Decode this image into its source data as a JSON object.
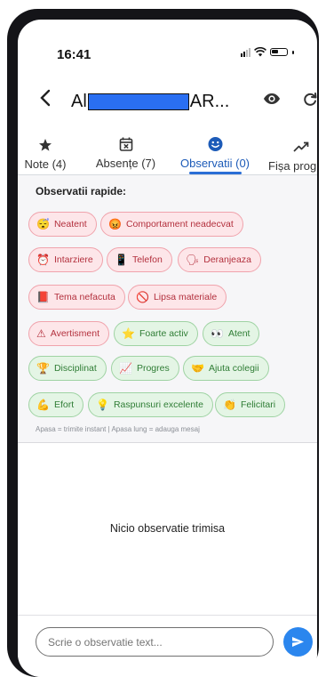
{
  "status_bar": {
    "time": "16:41"
  },
  "app_bar": {
    "title_prefix": "Al",
    "title_suffix": "AR...",
    "back_icon": "chevron-left-icon",
    "eye_icon": "eye-icon",
    "refresh_icon": "refresh-icon"
  },
  "tabs": [
    {
      "label": "Note (4)",
      "icon": "star-icon"
    },
    {
      "label": "Absențe (7)",
      "icon": "calendar-x-icon"
    },
    {
      "label": "Observatii (0)",
      "icon": "smiley-icon",
      "active": true
    },
    {
      "label": "Fișa progr",
      "icon": "trending-up-icon"
    }
  ],
  "quick": {
    "title": "Observatii rapide:",
    "chips": [
      {
        "label": "Neatent",
        "emoji": "😴",
        "tone": "red"
      },
      {
        "label": "Comportament neadecvat",
        "emoji": "😡",
        "tone": "red"
      },
      {
        "label": "Intarziere",
        "emoji": "⏰",
        "tone": "red"
      },
      {
        "label": "Telefon",
        "emoji": "📱",
        "tone": "red"
      },
      {
        "label": "Deranjeaza",
        "emoji": "🗣",
        "tone": "red"
      },
      {
        "label": "Tema nefacuta",
        "emoji": "📕",
        "tone": "red"
      },
      {
        "label": "Lipsa materiale",
        "emoji": "🚫",
        "tone": "red"
      },
      {
        "label": "Avertisment",
        "emoji": "⚠",
        "tone": "red"
      },
      {
        "label": "Foarte activ",
        "emoji": "⭐",
        "tone": "green"
      },
      {
        "label": "Atent",
        "emoji": "👀",
        "tone": "green"
      },
      {
        "label": "Disciplinat",
        "emoji": "🏆",
        "tone": "green"
      },
      {
        "label": "Progres",
        "emoji": "📈",
        "tone": "green"
      },
      {
        "label": "Ajuta colegii",
        "emoji": "🤝",
        "tone": "green"
      },
      {
        "label": "Efort",
        "emoji": "💪",
        "tone": "green"
      },
      {
        "label": "Raspunsuri excelente",
        "emoji": "💡",
        "tone": "green"
      },
      {
        "label": "Felicitari",
        "emoji": "👏",
        "tone": "green"
      }
    ],
    "hint": "Apasa = trimite instant | Apasa lung = adauga mesaj"
  },
  "empty_state": "Nicio observatie trimisa",
  "composer": {
    "placeholder": "Scrie o observatie text...",
    "send_icon": "send-icon"
  },
  "colors": {
    "accent": "#2a6ed6",
    "send": "#2b86ee",
    "negative_bg": "#fde6e9",
    "positive_bg": "#e4f5e5"
  }
}
